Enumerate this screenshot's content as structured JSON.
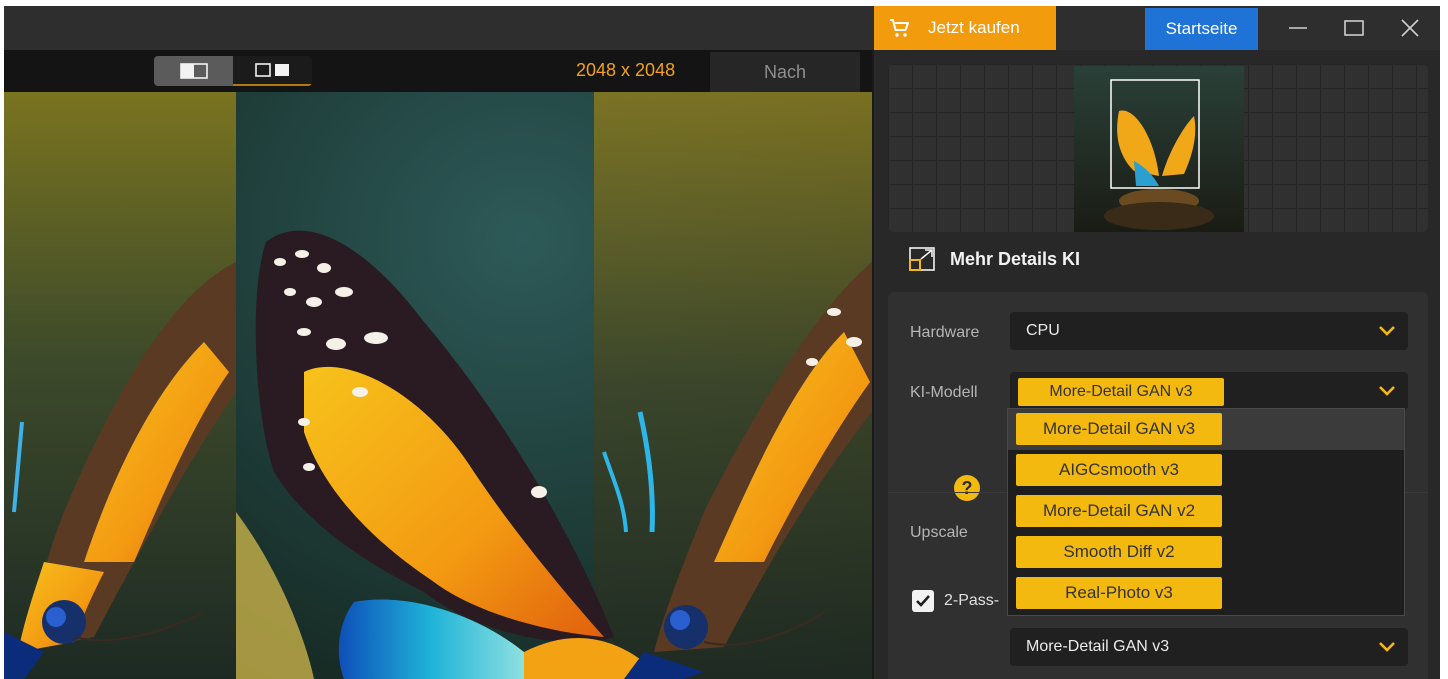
{
  "titlebar": {
    "buy_label": "Jetzt kaufen",
    "home_label": "Startseite",
    "buy_color": "#f29b0c",
    "home_color": "#1f73d6"
  },
  "viewer": {
    "resolution": "2048 x 2048",
    "after_tab": "Nach"
  },
  "panel": {
    "section_title": "Mehr Details KI",
    "hardware_label": "Hardware",
    "hardware_value": "CPU",
    "model_label": "KI-Modell",
    "model_value": "More-Detail GAN  v3",
    "upscale_label": "Upscale",
    "twopass_label": "2-Pass-",
    "twopass_checked": true,
    "second_model_value": "More-Detail GAN  v3",
    "help_symbol": "?"
  },
  "model_options": [
    {
      "label": "More-Detail GAN  v3",
      "highlighted": true
    },
    {
      "label": "AIGCsmooth  v3",
      "highlighted": false
    },
    {
      "label": "More-Detail GAN  v2",
      "highlighted": false
    },
    {
      "label": "Smooth Diff  v2",
      "highlighted": false
    },
    {
      "label": "Real-Photo  v3",
      "highlighted": false
    }
  ],
  "accent_color": "#f4b90f"
}
